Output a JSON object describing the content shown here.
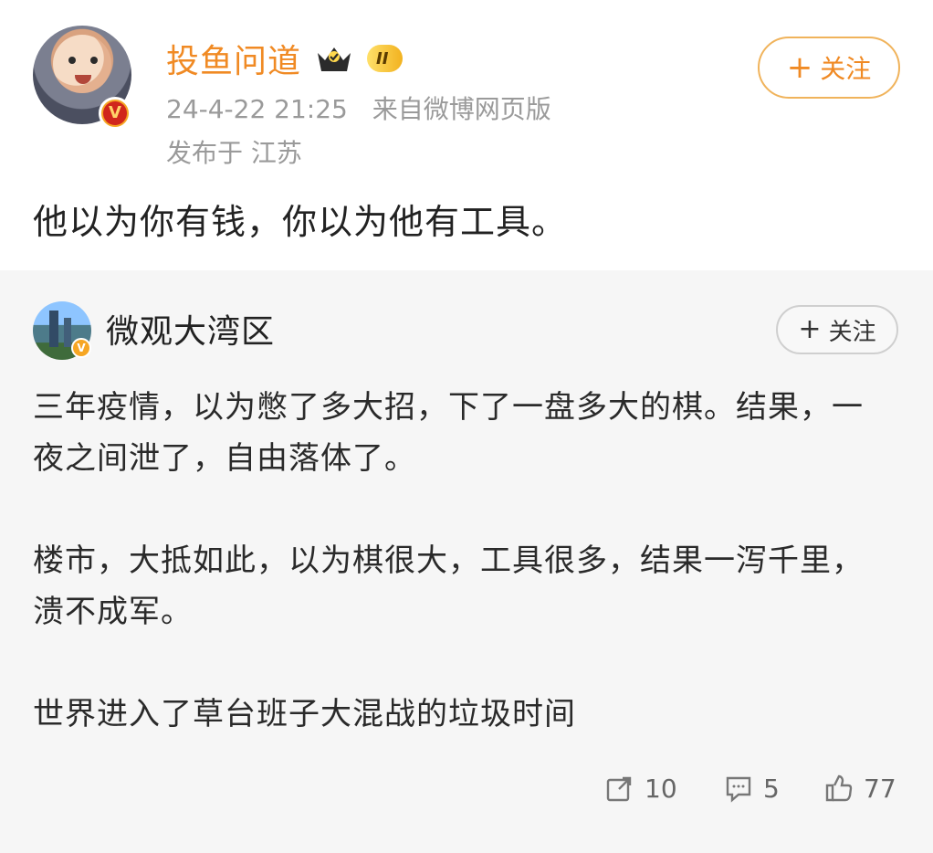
{
  "post": {
    "username": "投鱼问道",
    "level_badge": "II",
    "time": "24-4-22 21:25",
    "source": "来自微博网页版",
    "location": "发布于 江苏",
    "content": "他以为你有钱，你以为他有工具。",
    "follow_label": "关注"
  },
  "repost": {
    "username": "微观大湾区",
    "follow_label": "关注",
    "paragraphs": [
      "三年疫情，以为憋了多大招，下了一盘多大的棋。结果，一夜之间泄了，自由落体了。",
      "楼市，大抵如此，以为棋很大，工具很多，结果一泻千里，溃不成军。",
      "世界进入了草台班子大混战的垃圾时间"
    ],
    "actions": {
      "share_count": "10",
      "comment_count": "5",
      "like_count": "77"
    }
  },
  "icons": {
    "share": "share-icon",
    "comment": "comment-icon",
    "like": "like-icon",
    "crown": "crown-icon",
    "verified": "verified-badge-icon"
  },
  "colors": {
    "accent": "#f08a24",
    "muted": "#9a9a9a",
    "repost_bg": "#f6f6f6"
  }
}
